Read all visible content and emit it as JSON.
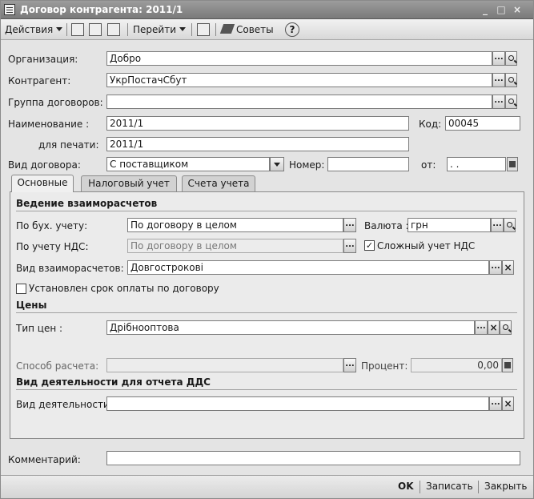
{
  "window": {
    "title": "Договор контрагента: 2011/1",
    "minimize": "_",
    "maximize": "□",
    "close": "×"
  },
  "toolbar": {
    "actions_label": "Действия",
    "goto_label": "Перейти",
    "tips_label": "Советы",
    "help_glyph": "?"
  },
  "form": {
    "org_label": "Организация:",
    "org_value": "Добро",
    "contractor_label": "Контрагент:",
    "contractor_value": "УкрПостачСбут",
    "group_label": "Группа договоров:",
    "group_value": "",
    "name_label": "Наименование :",
    "name_value": "2011/1",
    "code_label": "Код:",
    "code_value": "00045",
    "print_label": "для печати:",
    "print_value": "2011/1",
    "kind_label": "Вид договора:",
    "kind_value": "С поставщиком",
    "number_label": "Номер:",
    "number_value": "",
    "from_label": "от:",
    "from_value": ". ."
  },
  "tabs": [
    {
      "label": "Основные"
    },
    {
      "label": "Налоговый учет"
    },
    {
      "label": "Счета учета"
    }
  ],
  "main": {
    "settlements_section": "Ведение взаиморасчетов",
    "acc_label": "По бух. учету:",
    "acc_value": "По договору в целом",
    "currency_label": "Валюта :",
    "currency_value": "грн",
    "vat_label": "По учету НДС:",
    "vat_value": "По договору в целом",
    "complex_vat_label": "Сложный  учет НДС",
    "complex_vat_checked": true,
    "settlement_kind_label": "Вид взаиморасчетов:",
    "settlement_kind_value": "Довгострокові",
    "payment_term_label": "Установлен срок оплаты по договору",
    "payment_term_checked": false,
    "prices_section": "Цены",
    "price_type_label": "Тип цен :",
    "price_type_value": "Дрібнооптова",
    "calc_method_label": "Способ расчета:",
    "calc_method_value": "",
    "percent_label": "Процент:",
    "percent_value": "0,00",
    "dds_section": "Вид деятельности для отчета ДДС",
    "activity_label": "Вид деятельности:",
    "activity_value": ""
  },
  "comment": {
    "label": "Комментарий:",
    "value": ""
  },
  "footer": {
    "ok": "OK",
    "save": "Записать",
    "close": "Закрыть"
  }
}
